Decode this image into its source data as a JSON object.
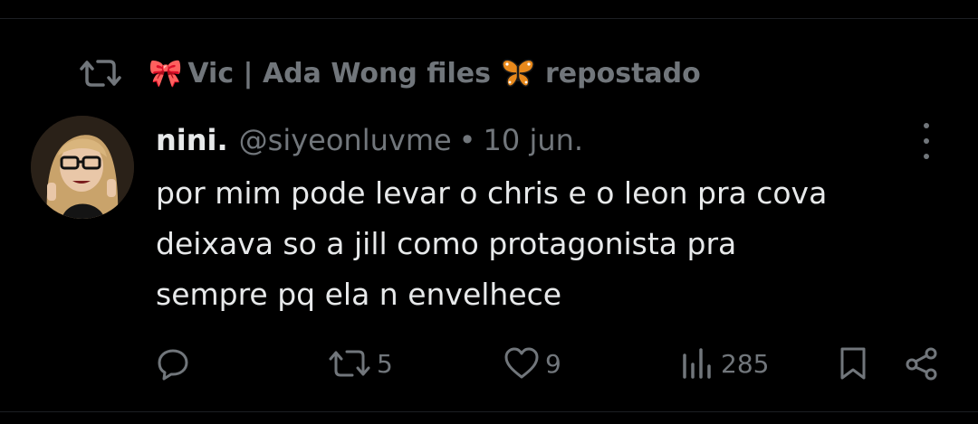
{
  "repost": {
    "ribbon": "🎀",
    "user": "Vic | Ada Wong files",
    "label": "repostado"
  },
  "tweet": {
    "display_name": "nini.",
    "handle": "@siyeonluvme",
    "separator": "•",
    "date": "10 jun.",
    "text": "por mim pode levar o chris e o leon pra cova\ndeixava so a jill como protagonista pra\nsempre pq ela n envelhece"
  },
  "actions": {
    "reposts": "5",
    "likes": "9",
    "views": "285"
  },
  "icons": {
    "repost": "repost-icon",
    "butterfly": "butterfly-icon",
    "reply": "reply-icon",
    "like": "heart-icon",
    "views": "views-icon",
    "bookmark": "bookmark-icon",
    "share": "share-icon",
    "more": "more-icon"
  },
  "colors": {
    "background": "#000000",
    "text": "#e7e9ea",
    "muted": "#71767b",
    "butterfly": "#e8891c"
  }
}
